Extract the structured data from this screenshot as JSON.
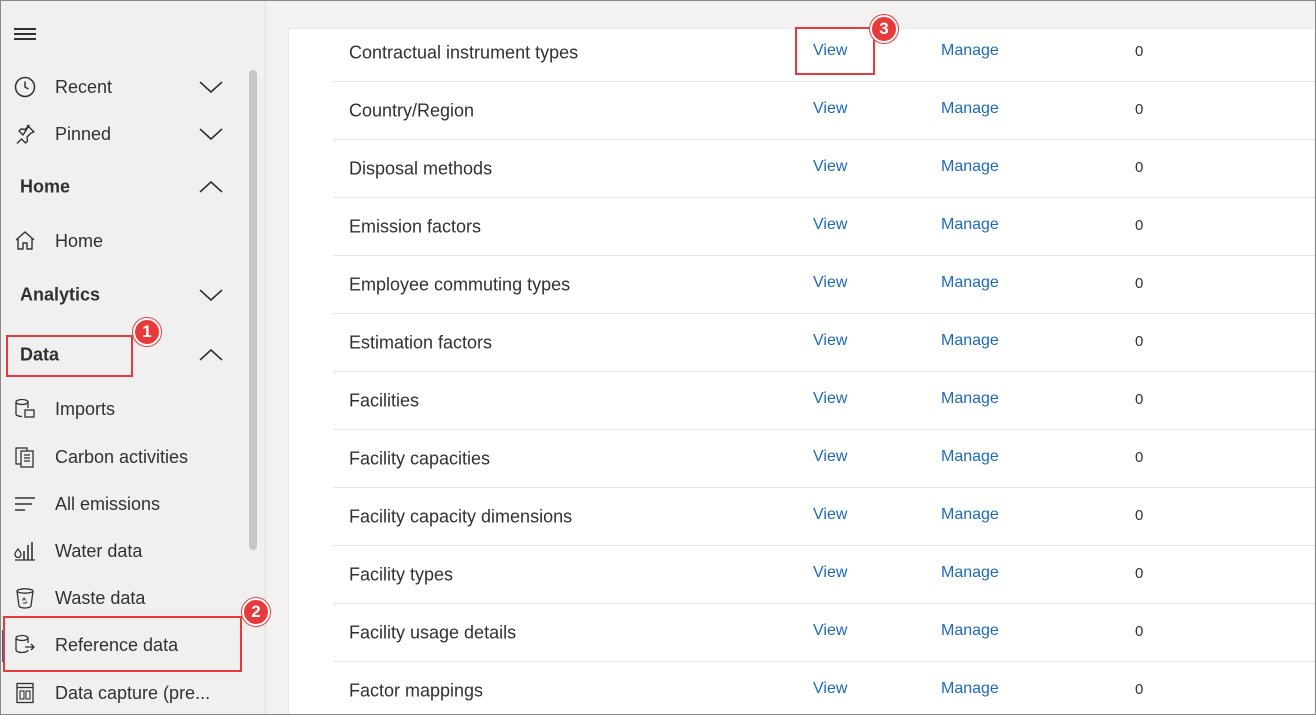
{
  "sidebar": {
    "items": {
      "recent": "Recent",
      "pinned": "Pinned",
      "home_section": "Home",
      "home": "Home",
      "analytics_section": "Analytics",
      "data_section": "Data",
      "imports": "Imports",
      "carbon_activities": "Carbon activities",
      "all_emissions": "All emissions",
      "water_data": "Water data",
      "waste_data": "Waste data",
      "reference_data": "Reference data",
      "data_capture": "Data capture (pre..."
    }
  },
  "table": {
    "rows": [
      {
        "name": "Contractual instrument types",
        "view": "View",
        "manage": "Manage",
        "count": "0"
      },
      {
        "name": "Country/Region",
        "view": "View",
        "manage": "Manage",
        "count": "0"
      },
      {
        "name": "Disposal methods",
        "view": "View",
        "manage": "Manage",
        "count": "0"
      },
      {
        "name": "Emission factors",
        "view": "View",
        "manage": "Manage",
        "count": "0"
      },
      {
        "name": "Employee commuting types",
        "view": "View",
        "manage": "Manage",
        "count": "0"
      },
      {
        "name": "Estimation factors",
        "view": "View",
        "manage": "Manage",
        "count": "0"
      },
      {
        "name": "Facilities",
        "view": "View",
        "manage": "Manage",
        "count": "0"
      },
      {
        "name": "Facility capacities",
        "view": "View",
        "manage": "Manage",
        "count": "0"
      },
      {
        "name": "Facility capacity dimensions",
        "view": "View",
        "manage": "Manage",
        "count": "0"
      },
      {
        "name": "Facility types",
        "view": "View",
        "manage": "Manage",
        "count": "0"
      },
      {
        "name": "Facility usage details",
        "view": "View",
        "manage": "Manage",
        "count": "0"
      },
      {
        "name": "Factor mappings",
        "view": "View",
        "manage": "Manage",
        "count": "0"
      }
    ]
  },
  "callouts": {
    "one": "1",
    "two": "2",
    "three": "3"
  },
  "colors": {
    "accent": "#1d6ab8",
    "callout": "#e83a3a",
    "sidebar_bg": "#f0f0f0"
  }
}
